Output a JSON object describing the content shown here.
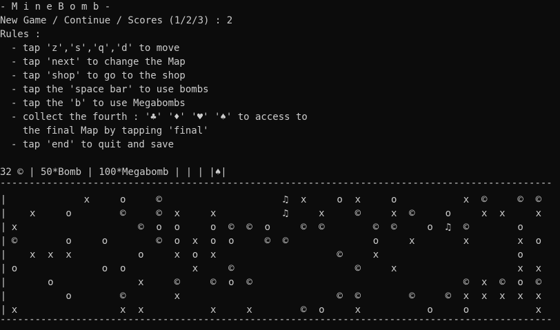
{
  "title": "- M i n e B o m b -",
  "menu_prompt": "New Game / Continue / Scores (1/2/3) : 2",
  "rules": {
    "header": "Rules :",
    "items": [
      "- tap 'z','s','q','d' to move",
      "- tap 'next' to change the Map",
      "- tap 'shop' to go to the shop",
      "- tap the 'space bar' to use bombs",
      "- tap the 'b' to use Megabombs",
      "- collect the fourth : '♣' '♦' '♥' '♠' to access to",
      "  the final Map by tapping 'final'",
      "- tap 'end' to quit and save"
    ]
  },
  "status_bar": "32 © | 50*Bomb | 100*Megabomb | | | |♠|",
  "board": {
    "border_rule": "------------------------------------------------------------------------------------------------------------------------",
    "left_wall": "|",
    "rows": [
      [
        "",
        "",
        "",
        "",
        "x",
        "",
        "o",
        "",
        "©",
        "",
        "",
        "",
        "",
        "",
        "",
        "♫",
        "x",
        "",
        "o",
        "x",
        "",
        "o",
        "",
        "",
        "",
        "x",
        "©",
        "",
        "©",
        "©"
      ],
      [
        "",
        "x",
        "",
        "o",
        "",
        "",
        "©",
        "",
        "©",
        "x",
        "",
        "x",
        "",
        "",
        "",
        "♫",
        "",
        "x",
        "",
        "©",
        "",
        "x",
        "©",
        "",
        "o",
        "",
        "x",
        "x",
        "",
        "x"
      ],
      [
        "x",
        "",
        "",
        "",
        "",
        "",
        "",
        "©",
        "o",
        "o",
        "",
        "o",
        "©",
        "©",
        "o",
        "",
        "©",
        "©",
        "",
        "",
        "©",
        "©",
        "",
        "o",
        "♫",
        "©",
        "",
        "",
        "o",
        ""
      ],
      [
        "©",
        "",
        "",
        "o",
        "",
        "o",
        "",
        "",
        "©",
        "o",
        "x",
        "o",
        "o",
        "",
        "©",
        "©",
        "",
        "",
        "",
        "",
        "o",
        "",
        "x",
        "",
        "",
        "x",
        "",
        "",
        "x",
        "o"
      ],
      [
        "",
        "x",
        "x",
        "x",
        "",
        "",
        "",
        "o",
        "",
        "x",
        "o",
        "x",
        "",
        "",
        "",
        "",
        "",
        "",
        "©",
        "",
        "x",
        "",
        "",
        "",
        "",
        "",
        "",
        "",
        "o",
        ""
      ],
      [
        "o",
        "",
        "",
        "",
        "",
        "o",
        "o",
        "",
        "",
        "",
        "x",
        "",
        "©",
        "",
        "",
        "",
        "",
        "",
        "",
        "©",
        "",
        "x",
        "",
        "",
        "",
        "",
        "",
        "",
        "x",
        "x"
      ],
      [
        "",
        "",
        "o",
        "",
        "",
        "",
        "",
        "x",
        "",
        "©",
        "",
        "©",
        "o",
        "©",
        "",
        "",
        "",
        "",
        "",
        "",
        "",
        "",
        "",
        "",
        "",
        "©",
        "x",
        "©",
        "o",
        "©"
      ],
      [
        "",
        "",
        "",
        "o",
        "",
        "",
        "©",
        "",
        "",
        "x",
        "",
        "",
        "",
        "",
        "",
        "",
        "",
        "",
        "©",
        "©",
        "",
        "",
        "©",
        "",
        "©",
        "x",
        "x",
        "x",
        "x",
        "x"
      ],
      [
        "x",
        "",
        "",
        "",
        "",
        "",
        "x",
        "x",
        "",
        "",
        "",
        "x",
        "",
        "x",
        "",
        "",
        "©",
        "o",
        "",
        "x",
        "",
        "",
        "",
        "o",
        "",
        "o",
        "",
        "",
        "",
        "x"
      ]
    ]
  },
  "colors": {
    "background": "#0c0c0c",
    "text": "#cccccc"
  }
}
